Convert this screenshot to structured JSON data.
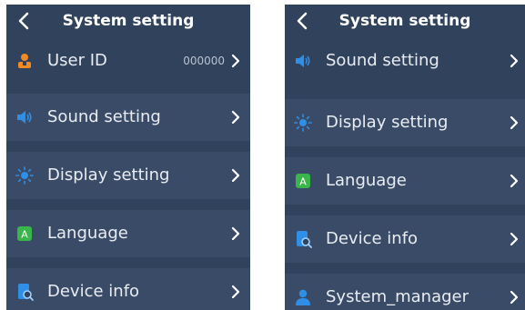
{
  "left": {
    "title": "System setting",
    "items": [
      {
        "label": "User ID",
        "value": "000000",
        "icon": "user-id-icon"
      },
      {
        "label": "Sound setting",
        "icon": "speaker-icon"
      },
      {
        "label": "Display setting",
        "icon": "brightness-icon"
      },
      {
        "label": "Language",
        "icon": "language-icon"
      },
      {
        "label": "Device info",
        "icon": "device-info-icon"
      }
    ]
  },
  "right": {
    "title": "System setting",
    "items": [
      {
        "label": "Sound setting",
        "icon": "speaker-icon"
      },
      {
        "label": "Display setting",
        "icon": "brightness-icon"
      },
      {
        "label": "Language",
        "icon": "language-icon"
      },
      {
        "label": "Device info",
        "icon": "device-info-icon"
      },
      {
        "label": "System_manager",
        "icon": "system-manager-icon"
      }
    ]
  },
  "colors": {
    "background": "#31425d",
    "row": "#3a4b67",
    "text": "#e9edf3",
    "accent_blue": "#2f8fe6",
    "accent_green": "#39b54a",
    "accent_orange": "#f08a24"
  }
}
